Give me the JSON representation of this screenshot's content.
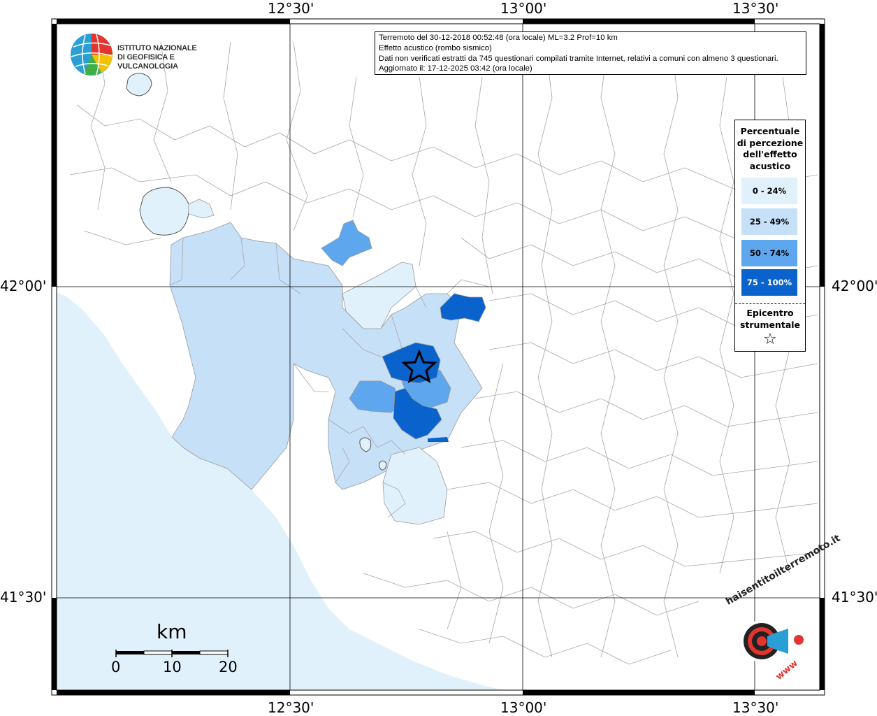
{
  "map": {
    "axes": {
      "top_labels": [
        "12°30'",
        "13°00'",
        "13°30'"
      ],
      "bottom_labels": [
        "12°30'",
        "13°00'",
        "13°30'"
      ],
      "left_labels": [
        "42°00'",
        "41°30'"
      ],
      "right_labels": [
        "42°00'",
        "41°30'"
      ]
    },
    "info": {
      "line1": "Terremoto del 30-12-2018 00:52:48 (ora locale) ML=3.2 Prof=10 km",
      "line2": "Effetto acustico (rombo sismico)",
      "line3": "Dati non verificati estratti da 745 questionari compilati tramite Internet, relativi a comuni con almeno 3 questionari.",
      "line4": "Aggiornato il: 17-12-2025 03:42 (ora locale)"
    },
    "logo": {
      "line1": "ISTITUTO NAZIONALE",
      "line2": "DI GEOFISICA E VULCANOLOGIA"
    },
    "legend": {
      "title_lines": [
        "Percentuale",
        "di percezione",
        "dell'effetto",
        "acustico"
      ],
      "items": [
        {
          "label": "0 - 24%",
          "color": "#e1f1fc",
          "text_color": "#000000"
        },
        {
          "label": "25 - 49%",
          "color": "#c6e0f8",
          "text_color": "#000000"
        },
        {
          "label": "50 - 74%",
          "color": "#5ea6ee",
          "text_color": "#000000"
        },
        {
          "label": "75 - 100%",
          "color": "#0a63cc",
          "text_color": "#ffffff"
        }
      ],
      "epicenter_lines": [
        "Epicentro",
        "strumentale"
      ],
      "epicenter_symbol": "☆"
    },
    "scale": {
      "title": "km",
      "ticks": [
        "0",
        "10",
        "20"
      ]
    },
    "watermark": {
      "text": "haisentitoilterremoto.it",
      "subtext": "www",
      "icon": "speaker-target-icon"
    },
    "colors": {
      "sea": "#e1f1fc",
      "land": "#ffffff",
      "borders": "#9a9a9a",
      "epicenter_star": "#000000"
    }
  }
}
